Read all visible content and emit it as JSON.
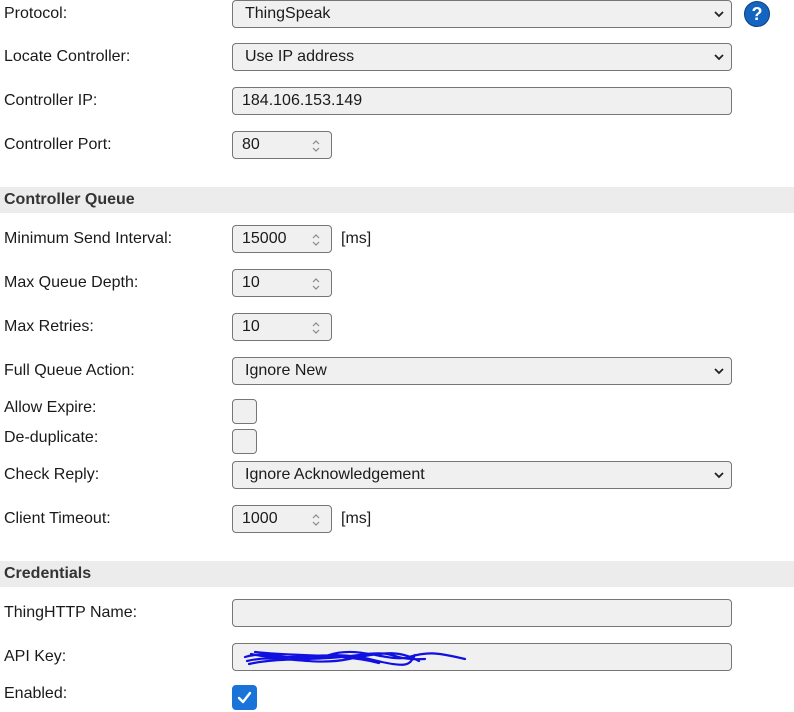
{
  "protocol": {
    "label": "Protocol:",
    "value": "ThingSpeak",
    "help_icon": "?"
  },
  "locate_controller": {
    "label": "Locate Controller:",
    "value": "Use IP address"
  },
  "controller_ip": {
    "label": "Controller IP:",
    "value": "184.106.153.149"
  },
  "controller_port": {
    "label": "Controller Port:",
    "value": "80"
  },
  "controller_queue": {
    "heading": "Controller Queue",
    "min_send_interval": {
      "label": "Minimum Send Interval:",
      "value": "15000",
      "unit": "[ms]"
    },
    "max_queue_depth": {
      "label": "Max Queue Depth:",
      "value": "10"
    },
    "max_retries": {
      "label": "Max Retries:",
      "value": "10"
    },
    "full_queue_action": {
      "label": "Full Queue Action:",
      "value": "Ignore New"
    },
    "allow_expire": {
      "label": "Allow Expire:",
      "checked": false
    },
    "de_duplicate": {
      "label": "De-duplicate:",
      "checked": false
    },
    "check_reply": {
      "label": "Check Reply:",
      "value": "Ignore Acknowledgement"
    },
    "client_timeout": {
      "label": "Client Timeout:",
      "value": "1000",
      "unit": "[ms]"
    }
  },
  "credentials": {
    "heading": "Credentials",
    "thinghttp_name": {
      "label": "ThingHTTP Name:",
      "value": ""
    },
    "api_key": {
      "label": "API Key:",
      "redacted": true
    },
    "enabled": {
      "label": "Enabled:",
      "checked": true
    }
  },
  "colors": {
    "accent": "#1a73d9",
    "section_bg": "#ececec",
    "field_bg": "#f0f0f0",
    "redaction": "#1010e0"
  },
  "icons": {
    "select": "chevron-down-icon",
    "number": "spinner-icon",
    "help": "help-icon",
    "check": "checkmark-icon"
  }
}
